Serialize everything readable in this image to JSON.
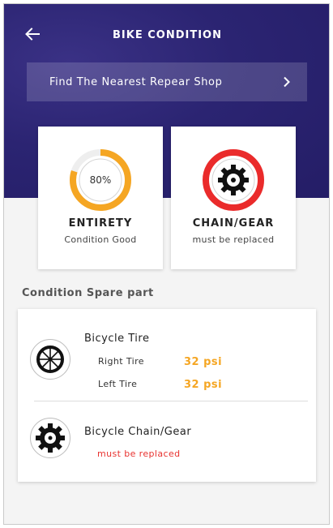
{
  "header": {
    "title": "BIKE CONDITION",
    "back_icon": "arrow-left-icon"
  },
  "repair": {
    "label": "Find The Nearest Repear Shop",
    "icon": "chevron-right-icon"
  },
  "summary": {
    "entirety": {
      "percent_label": "80%",
      "percent": 80,
      "title": "ENTIRETY",
      "status": "Condition Good",
      "color": "#f5a623"
    },
    "chain": {
      "title": "CHAIN/GEAR",
      "status": "must be replaced",
      "icon": "chainring-icon",
      "color": "#ea2b2b"
    }
  },
  "spare": {
    "section_title": "Condition Spare part",
    "tire": {
      "name": "Bicycle Tire",
      "icon": "wheel-icon",
      "rows": [
        {
          "label": "Right Tire",
          "value": "32 psi"
        },
        {
          "label": "Left Tire",
          "value": "32 psi"
        }
      ]
    },
    "chain": {
      "name": "Bicycle Chain/Gear",
      "icon": "chainring-icon",
      "status": "must be replaced"
    }
  },
  "colors": {
    "header_bg": "#2b2472",
    "accent_orange": "#f5a623",
    "warning_red": "#e8322f"
  }
}
